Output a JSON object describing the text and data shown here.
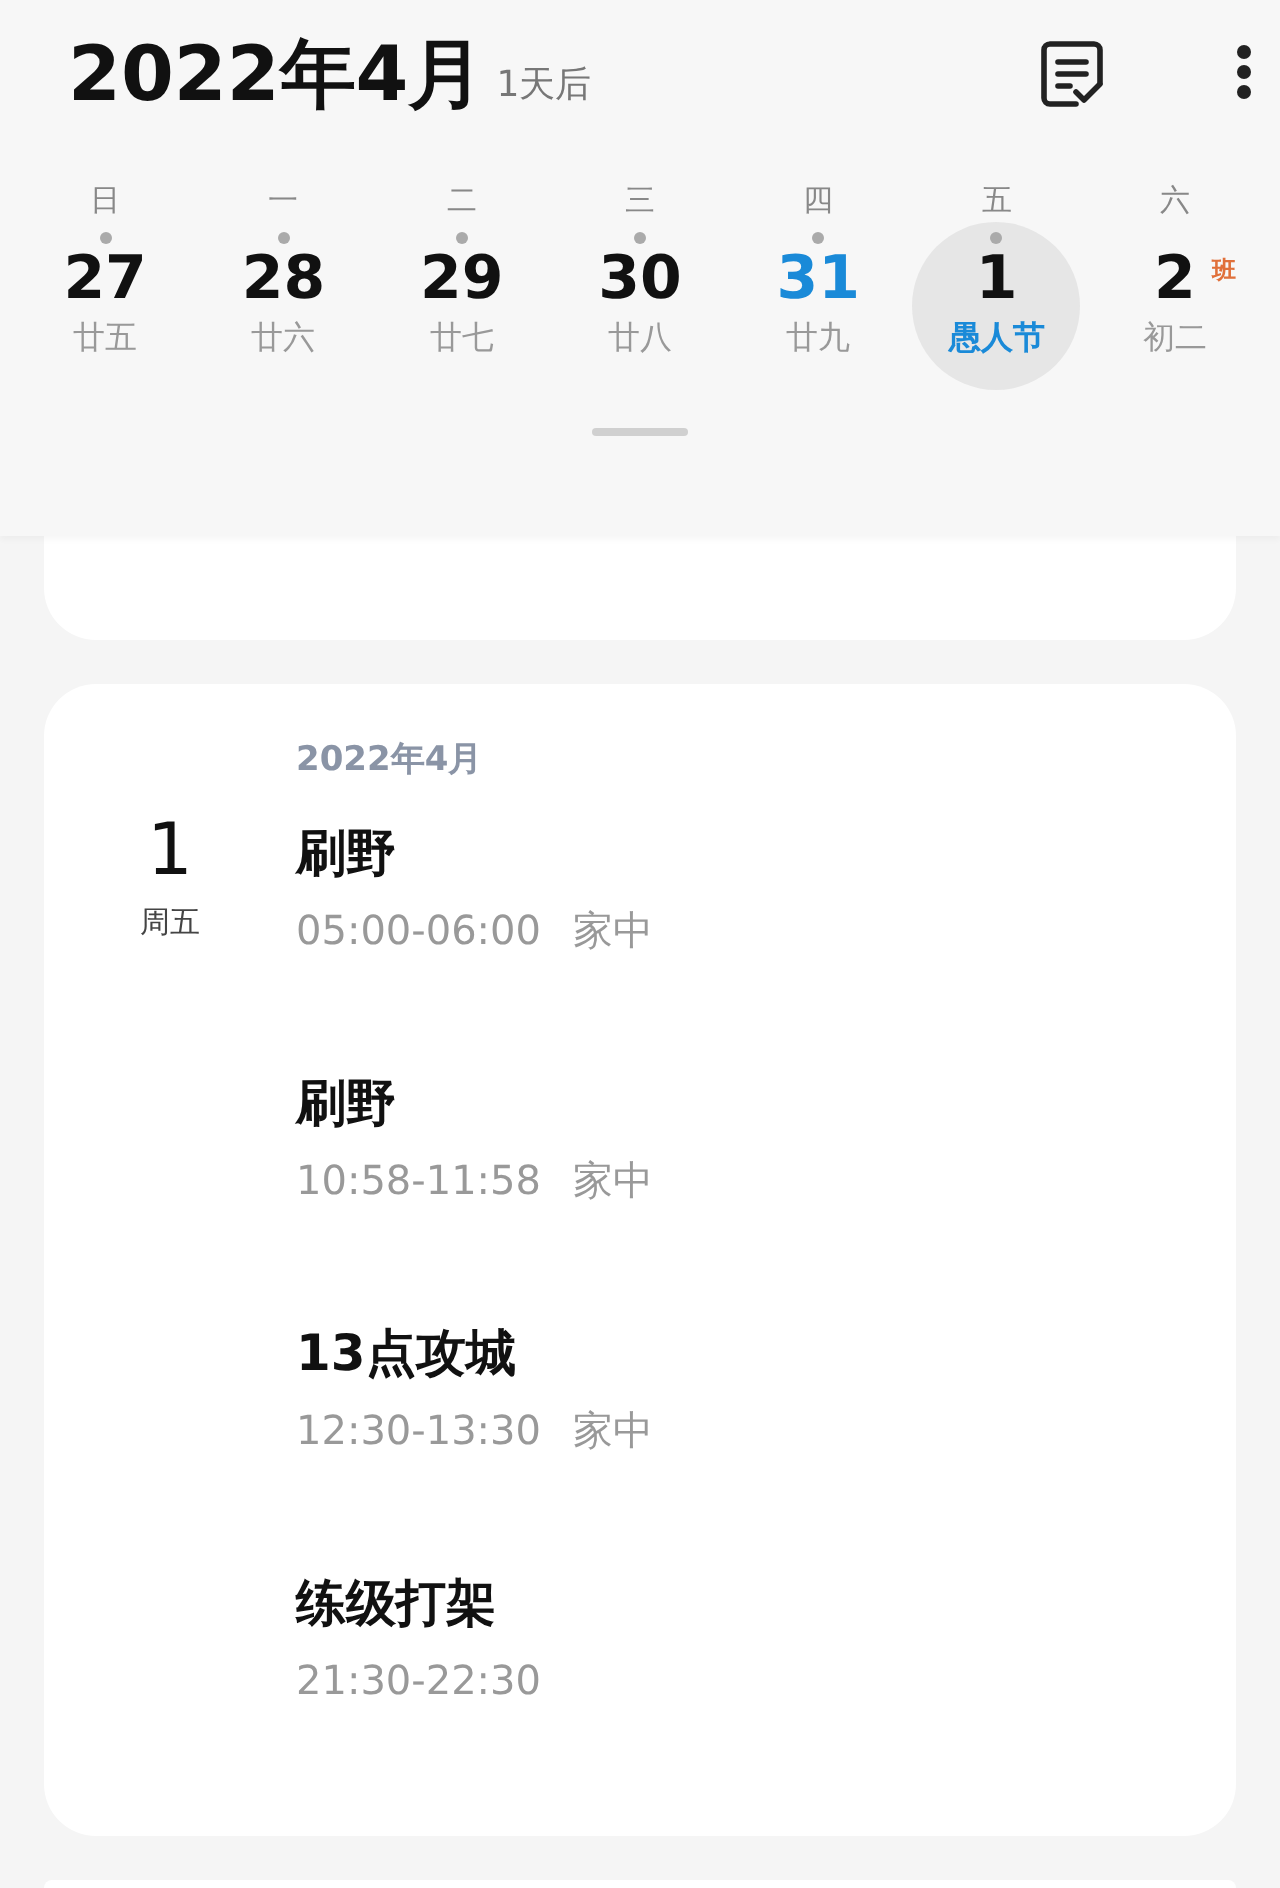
{
  "header": {
    "title": "2022年4月",
    "subtitle": "1天后"
  },
  "week": [
    {
      "weekday": "日",
      "day": "27",
      "lunar": "廿五",
      "dot": true,
      "today": false,
      "selected": false,
      "holiday": false
    },
    {
      "weekday": "一",
      "day": "28",
      "lunar": "廿六",
      "dot": true,
      "today": false,
      "selected": false,
      "holiday": false
    },
    {
      "weekday": "二",
      "day": "29",
      "lunar": "廿七",
      "dot": true,
      "today": false,
      "selected": false,
      "holiday": false
    },
    {
      "weekday": "三",
      "day": "30",
      "lunar": "廿八",
      "dot": true,
      "today": false,
      "selected": false,
      "holiday": false
    },
    {
      "weekday": "四",
      "day": "31",
      "lunar": "廿九",
      "dot": true,
      "today": true,
      "selected": false,
      "holiday": false
    },
    {
      "weekday": "五",
      "day": "1",
      "lunar": "愚人节",
      "dot": true,
      "today": false,
      "selected": true,
      "holiday": true
    },
    {
      "weekday": "六",
      "day": "2",
      "lunar": "初二",
      "dot": false,
      "today": false,
      "selected": false,
      "holiday": false,
      "badge": "班"
    }
  ],
  "agenda": {
    "month": "2022年4月",
    "day": "1",
    "weekday": "周五",
    "events": [
      {
        "title": "刷野",
        "time": "05:00-06:00",
        "place": "家中"
      },
      {
        "title": "刷野",
        "time": "10:58-11:58",
        "place": "家中"
      },
      {
        "title": "13点攻城",
        "time": "12:30-13:30",
        "place": "家中"
      },
      {
        "title": "练级打架",
        "time": "21:30-22:30"
      }
    ]
  }
}
